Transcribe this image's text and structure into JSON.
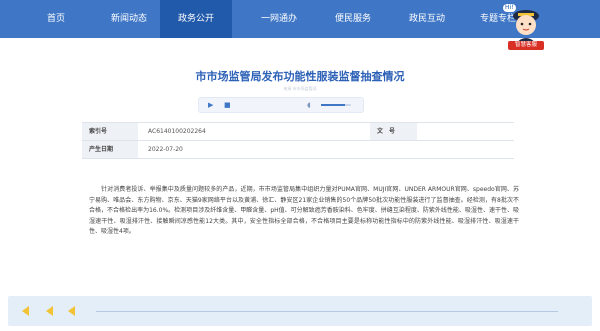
{
  "nav": {
    "items": [
      "首页",
      "新闻动态",
      "政务公开",
      "一网通办",
      "便民服务",
      "政民互动",
      "专题专栏"
    ],
    "active_index": 2
  },
  "assistant": {
    "bubble": "Hi!",
    "label": "智慧客服"
  },
  "article": {
    "title": "市市场监管局发布功能性服装监督抽查情况",
    "title_sub": "来源 市市场监管局",
    "meta": {
      "index_label": "索引号",
      "index_value": "AC6140100202264",
      "doc_no_label": "文　号",
      "doc_no_value": "",
      "date_label": "产生日期",
      "date_value": "2022-07-20"
    },
    "paragraph": "针对消费者投诉、举报集中及质量问题较多的产品，近期，市市场监管局集中组织力量对PUMA官网、MUJI官网、UNDER ARMOUR官网、speedo官网、苏宁易购、唯品会、东方购物、京东、天猫9家网络平台以及黄浦、徐汇、静安区21家企业销售的50个品牌50批次功能性服装进行了监督抽查。经检测，有8批次不合格，不合格检出率为16.0%。检测项目涉及纤维含量、甲醛含量、pH值、可分解致癌芳香胺染料、色牢度、拼缝互染程度、防紫外线性能、吸湿性、速干性、吸湿速干性、吸湿排汗性、接触瞬间凉感性能12大类。其中，安全性指标全部合格，不合格项目主要是标称功能性指标中的防紫外线性能、吸湿排汗性、吸湿速干性、吸湿性4项。"
  },
  "colors": {
    "nav_bg": "#3f77c6",
    "nav_active": "#2159ab",
    "title": "#2c61b7",
    "accent": "#f2c335"
  }
}
